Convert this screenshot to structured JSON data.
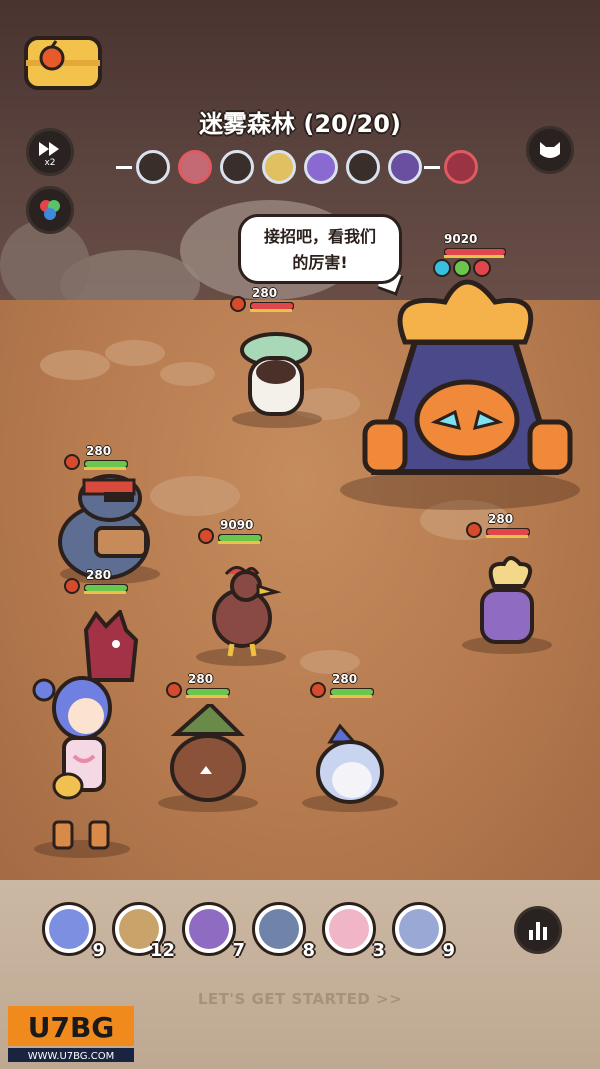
{
  "stage": {
    "title": "迷雾森林 (20/20)"
  },
  "buttons": {
    "speed_label": "x2"
  },
  "wave_track": {
    "dots": [
      {
        "color": "#d9e2ef"
      },
      {
        "color": "#e05a5f"
      },
      {
        "color": "#d9e2ef"
      },
      {
        "color": "#d9e2ef"
      },
      {
        "color": "#d9e2ef"
      },
      {
        "color": "#d9e2ef"
      },
      {
        "color": "#d9e2ef"
      },
      {
        "color": "#e05a5f"
      }
    ]
  },
  "dialogue": {
    "line1": "接招吧，看我们",
    "line2": "的厉害!"
  },
  "boss": {
    "hp": "9020",
    "name_icon": "volcano-monster"
  },
  "units": {
    "mushroom_hp": "280",
    "mole_hp": "280",
    "dragon_hp": "280",
    "rooster_hp": "9090",
    "wolf_hp": "280",
    "shark_hp": "280",
    "seed_hp": "280"
  },
  "roster": [
    {
      "name": "girl-hero",
      "level": "9",
      "color": "#7c8fe0"
    },
    {
      "name": "dog-cap",
      "level": "12",
      "color": "#c9a36a"
    },
    {
      "name": "seed-spirit",
      "level": "7",
      "color": "#8f6bc2"
    },
    {
      "name": "mole-bandit",
      "level": "8",
      "color": "#6f84a8"
    },
    {
      "name": "bunny",
      "level": "3",
      "color": "#f0b6c8"
    },
    {
      "name": "shark-kid",
      "level": "9",
      "color": "#9aa8d6"
    }
  ],
  "footer": {
    "start_text": "LET'S GET STARTED >>",
    "watermark_top": "U7BG",
    "watermark_bottom": "WWW.U7BG.COM"
  },
  "colors": {
    "hp_green": "#6ac64d",
    "hp_red": "#e0464a",
    "ground": "#b57a4e"
  }
}
